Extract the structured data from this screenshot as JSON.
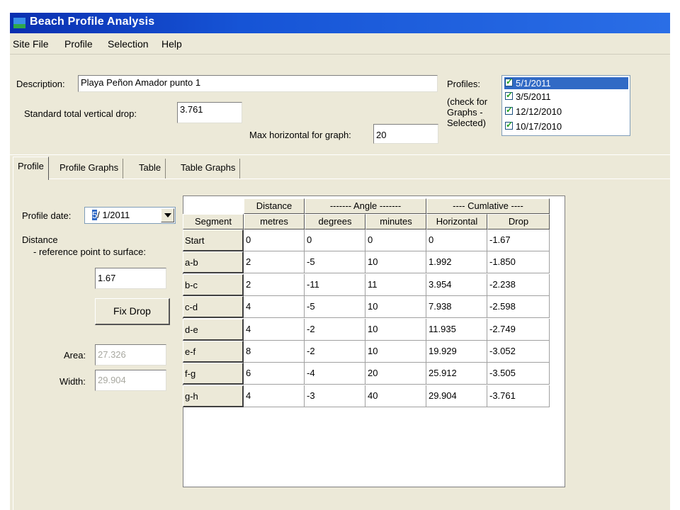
{
  "window": {
    "title": "Beach Profile Analysis"
  },
  "menu": [
    "Site File",
    "Profile",
    "Selection",
    "Help"
  ],
  "header": {
    "description_label": "Description:",
    "description_value": "Playa Peñon Amador punto 1",
    "std_drop_label": "Standard total vertical drop:",
    "std_drop_value": "3.761",
    "max_h_label": "Max horizontal for graph:",
    "max_h_value": "20",
    "profiles_label": [
      "Profiles:",
      "(check for",
      "Graphs -",
      "Selected)"
    ],
    "profiles": [
      {
        "date": "5/1/2011",
        "checked": true,
        "selected": true
      },
      {
        "date": "3/5/2011",
        "checked": true,
        "selected": false
      },
      {
        "date": "12/12/2010",
        "checked": true,
        "selected": false
      },
      {
        "date": "10/17/2010",
        "checked": true,
        "selected": false
      }
    ]
  },
  "tabs": [
    "Profile",
    "Profile Graphs",
    "Table",
    "Table Graphs"
  ],
  "profile_tab": {
    "date_label": "Profile date:",
    "date_sel": "5",
    "date_rest": "/ 1/2011",
    "distance_label": "Distance",
    "ref_label": "- reference point to surface:",
    "ref_value": "1.67",
    "fix_drop_label": "Fix Drop",
    "area_label": "Area:",
    "area_value": "27.326",
    "width_label": "Width:",
    "width_value": "29.904"
  },
  "table": {
    "group_headers": [
      "Distance",
      "------- Angle -------",
      "---- Cumlative ----"
    ],
    "columns": [
      "Segment",
      "metres",
      "degrees",
      "minutes",
      "Horizontal",
      "Drop"
    ],
    "rows": [
      [
        "Start",
        "0",
        "0",
        "0",
        "0",
        "-1.67"
      ],
      [
        "a-b",
        "2",
        "-5",
        "10",
        "1.992",
        "-1.850"
      ],
      [
        "b-c",
        "2",
        "-11",
        "11",
        "3.954",
        "-2.238"
      ],
      [
        "c-d",
        "4",
        "-5",
        "10",
        "7.938",
        "-2.598"
      ],
      [
        "d-e",
        "4",
        "-2",
        "10",
        "11.935",
        "-2.749"
      ],
      [
        "e-f",
        "8",
        "-2",
        "10",
        "19.929",
        "-3.052"
      ],
      [
        "f-g",
        "6",
        "-4",
        "20",
        "25.912",
        "-3.505"
      ],
      [
        "g-h",
        "4",
        "-3",
        "40",
        "29.904",
        "-3.761"
      ]
    ]
  }
}
